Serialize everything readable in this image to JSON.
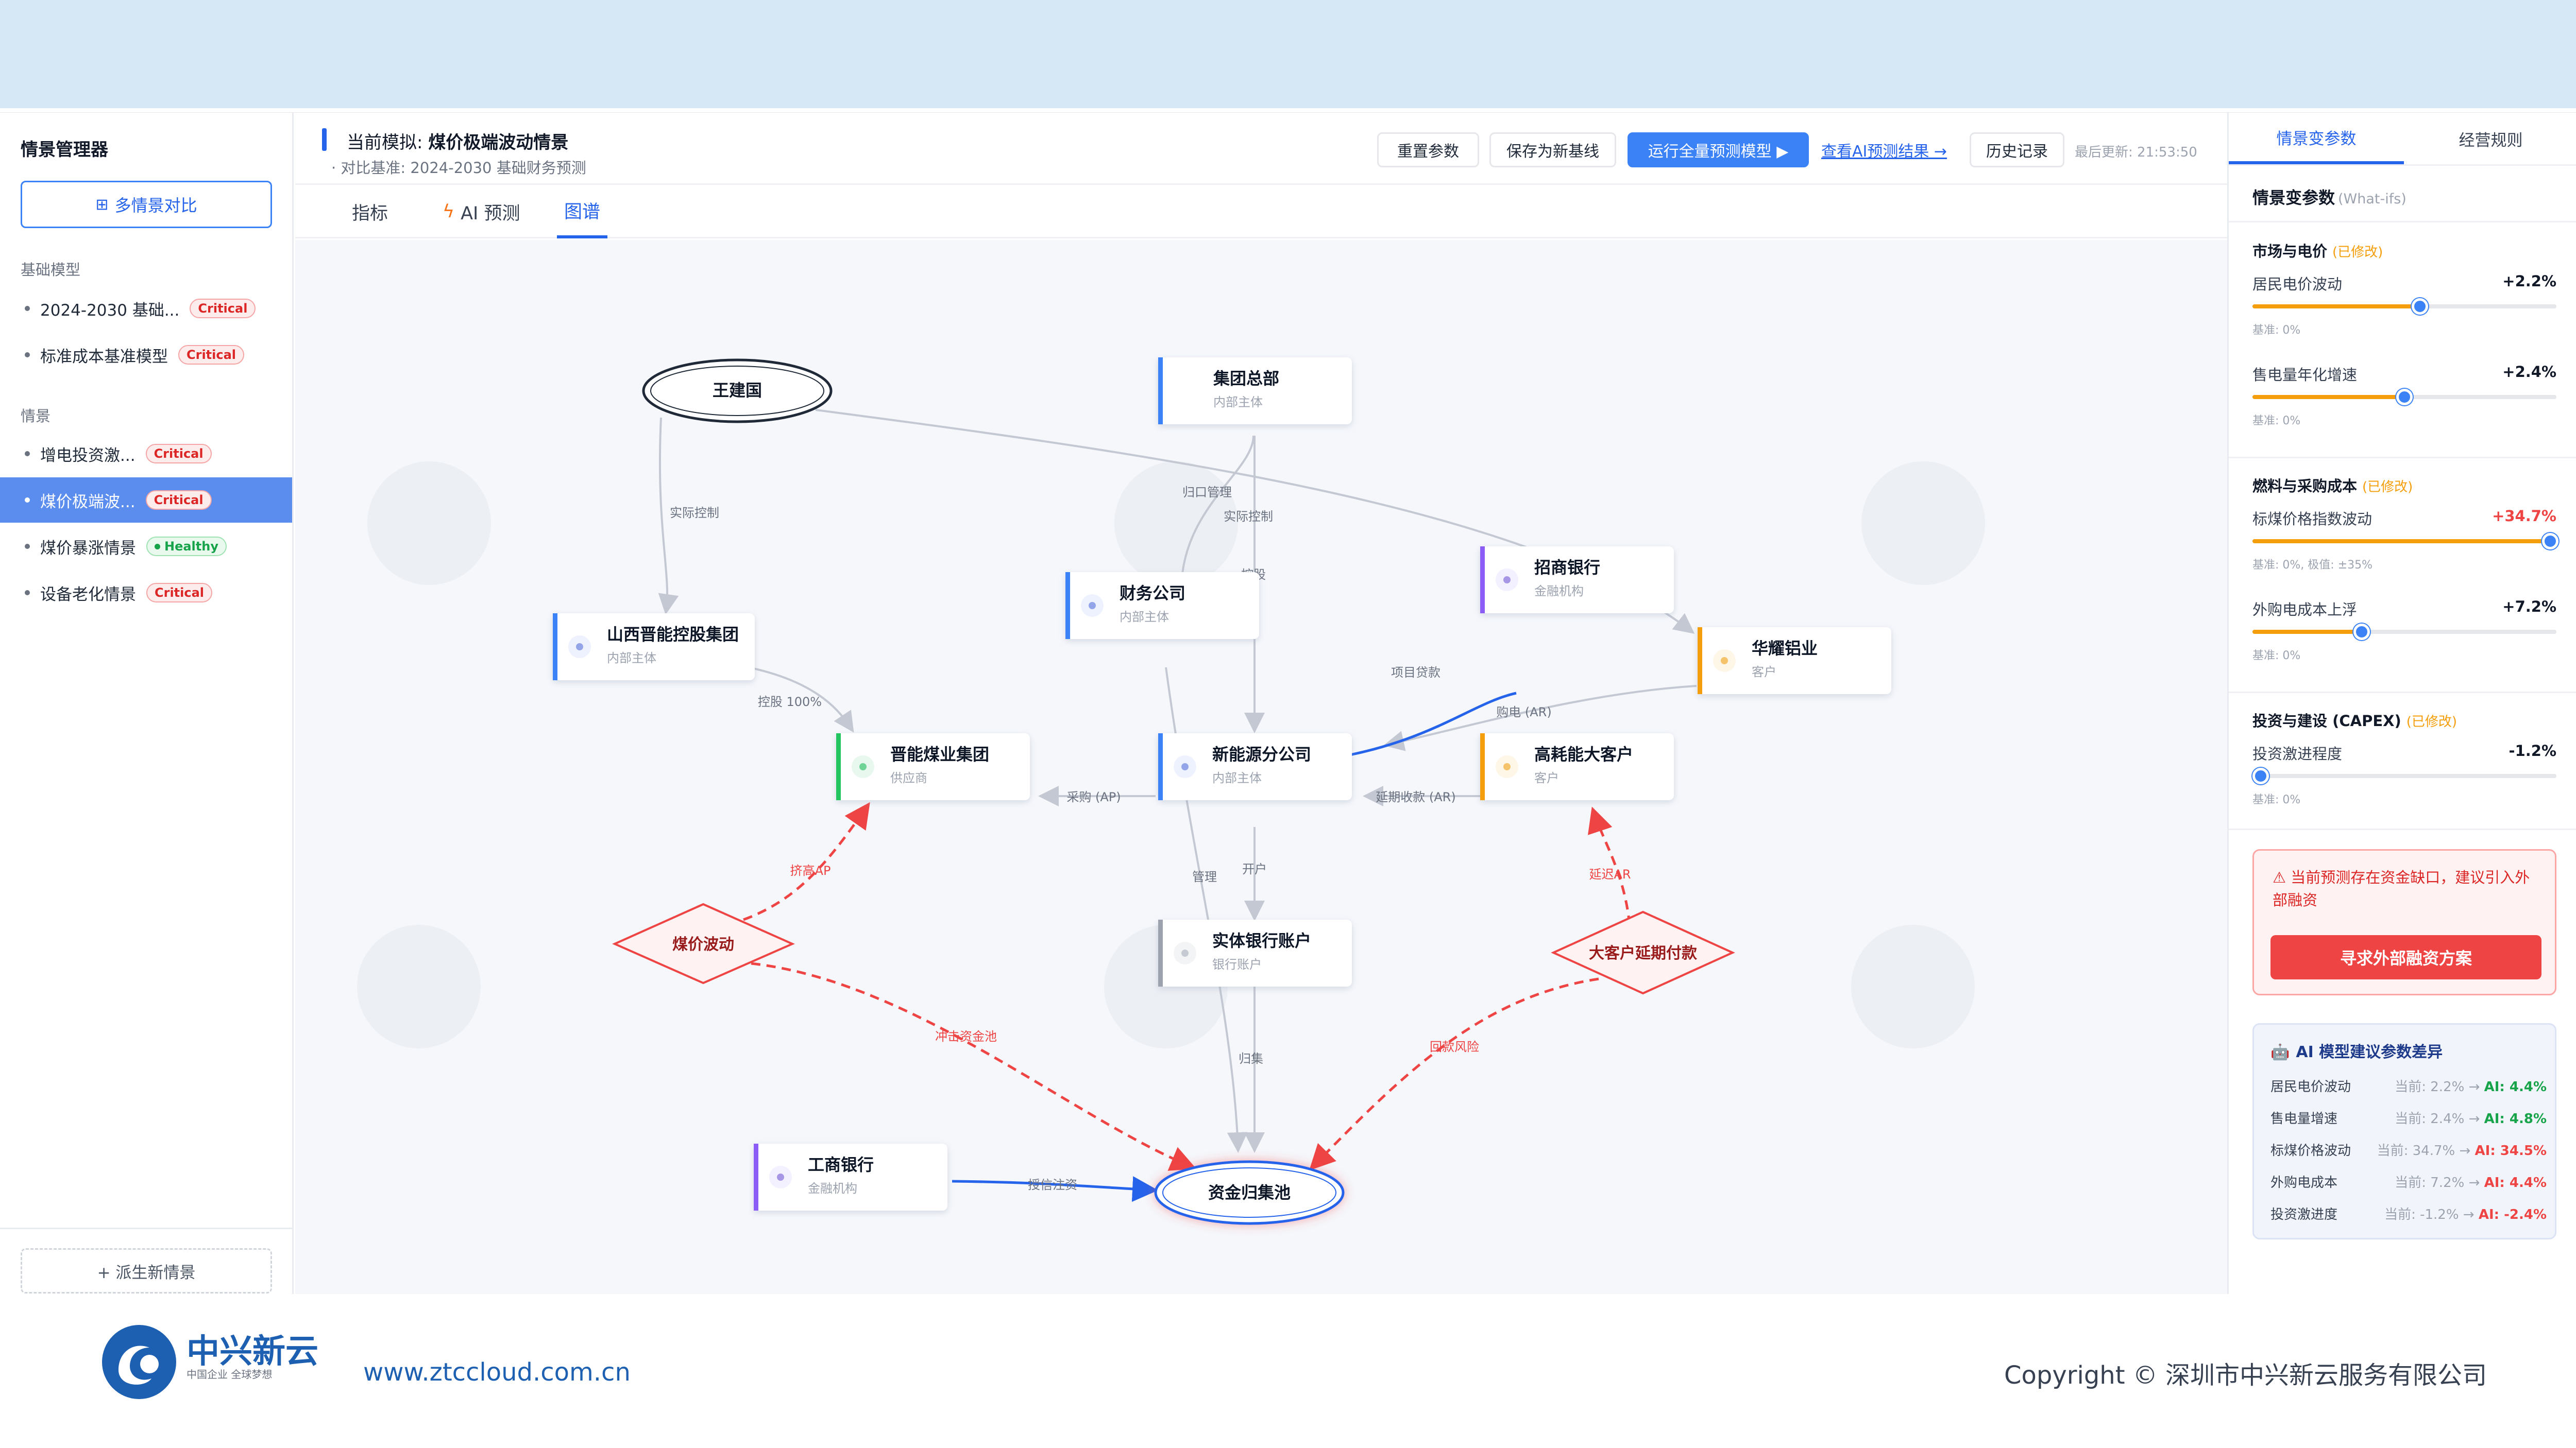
{
  "sidebar": {
    "title": "情景管理器",
    "compare_label": "多情景对比",
    "sections": {
      "base": "基础模型",
      "scenario": "情景"
    },
    "base_items": [
      {
        "label": "2024-2030 基础...",
        "status": "Critical"
      },
      {
        "label": "标准成本基准模型",
        "status": "Critical"
      }
    ],
    "scenario_items": [
      {
        "label": "增电投资激...",
        "status": "Critical"
      },
      {
        "label": "煤价极端波...",
        "status": "Critical"
      },
      {
        "label": "煤价暴涨情景",
        "status": "Healthy"
      },
      {
        "label": "设备老化情景",
        "status": "Critical"
      }
    ],
    "derive_label": "+ 派生新情景"
  },
  "header": {
    "title_prefix": "当前模拟:",
    "title": "煤价极端波动情景",
    "subtitle": "· 对比基准: 2024-2030 基础财务预测",
    "buttons": {
      "reset": "重置参数",
      "save": "保存为新基线",
      "run": "运行全量预测模型 ▶",
      "history": "历史记录"
    },
    "ai_link": "查看AI预测结果 →",
    "last_update": "最后更新: 21:53:50"
  },
  "tabs": [
    "指标",
    "AI 预测",
    "图谱"
  ],
  "graph": {
    "nodes": {
      "wang": {
        "label": "王建国"
      },
      "hq": {
        "label": "集团总部",
        "type": "内部主体"
      },
      "finance": {
        "label": "财务公司",
        "type": "内部主体"
      },
      "cmb": {
        "label": "招商银行",
        "type": "金融机构"
      },
      "huayao": {
        "label": "华耀铝业",
        "type": "客户"
      },
      "shanxi": {
        "label": "山西晋能控股集团",
        "type": "内部主体"
      },
      "coal": {
        "label": "晋能煤业集团",
        "type": "供应商"
      },
      "newenergy": {
        "label": "新能源分公司",
        "type": "内部主体"
      },
      "bigclient": {
        "label": "高耗能大客户",
        "type": "客户"
      },
      "bank_acct": {
        "label": "实体银行账户",
        "type": "银行账户"
      },
      "icbc": {
        "label": "工商银行",
        "type": "金融机构"
      },
      "pool": {
        "label": "资金归集池"
      },
      "coal_shock": {
        "label": "煤价波动"
      },
      "client_delay": {
        "label": "大客户延期付款"
      }
    },
    "edges": {
      "real_control": "实际控制",
      "real_control2": "实际控制",
      "consolidate": "归口管理",
      "hold": "控股",
      "project_loan": "项目贷款",
      "purchase_power": "购电 (AR)",
      "hold100": "控股 100%",
      "purchase_ap": "采购 (AP)",
      "delay_collect": "延期收款 (AR)",
      "open_acct": "开户",
      "manage": "管理",
      "squeeze_ap": "挤高AP",
      "delay_ar": "延迟AR",
      "impact_pool": "冲击资金池",
      "collect_risk": "回款风险",
      "pool_collect": "归集",
      "credit_inject": "授信注资"
    }
  },
  "rpanel": {
    "tabs": [
      "情景变参数",
      "经营规则"
    ],
    "title": "情景变参数",
    "title_sub": "(What-ifs)",
    "groups": [
      {
        "title": "市场与电价",
        "modified": "(已修改)",
        "params": [
          {
            "label": "居民电价波动",
            "value": "+2.2%",
            "base": "基准: 0%",
            "level": 0.55
          },
          {
            "label": "售电量年化增速",
            "value": "+2.4%",
            "base": "基准: 0%",
            "level": 0.5
          }
        ]
      },
      {
        "title": "燃料与采购成本",
        "modified": "(已修改)",
        "params": [
          {
            "label": "标煤价格指数波动",
            "value": "+34.7%",
            "base": "基准: 0%, 极值: ±35%",
            "level": 0.98
          },
          {
            "label": "外购电成本上浮",
            "value": "+7.2%",
            "base": "基准: 0%",
            "level": 0.36
          }
        ]
      },
      {
        "title": "投资与建设 (CAPEX)",
        "modified": "(已修改)",
        "params": [
          {
            "label": "投资激进程度",
            "value": "-1.2%",
            "base": "基准: 0%",
            "level": 0.0
          }
        ]
      }
    ],
    "alert": {
      "text": "⚠ 当前预测存在资金缺口，建议引入外部融资",
      "button": "寻求外部融资方案"
    },
    "ai": {
      "title": "AI 模型建议参数差异",
      "rows": [
        {
          "label": "居民电价波动",
          "current": "当前: 2.2% →",
          "ai": "AI: 4.4%",
          "tone": "g"
        },
        {
          "label": "售电量增速",
          "current": "当前: 2.4% →",
          "ai": "AI: 4.8%",
          "tone": "g"
        },
        {
          "label": "标煤价格波动",
          "current": "当前: 34.7% →",
          "ai": "AI: 34.5%",
          "tone": "r"
        },
        {
          "label": "外购电成本",
          "current": "当前: 7.2% →",
          "ai": "AI: 4.4%",
          "tone": "r"
        },
        {
          "label": "投资激进度",
          "current": "当前: -1.2% →",
          "ai": "AI: -2.4%",
          "tone": "r"
        }
      ]
    }
  },
  "footer": {
    "brand": "中兴新云",
    "brand_sub": "中国企业 全球梦想",
    "url": "www.ztccloud.com.cn",
    "copyright": "Copyright © 深圳市中兴新云服务有限公司"
  },
  "colors": {
    "accent": "#3b82f6",
    "critical": "#dc2626",
    "healthy": "#16a34a",
    "risk": "#ef4444",
    "modified": "#f59e0b"
  }
}
